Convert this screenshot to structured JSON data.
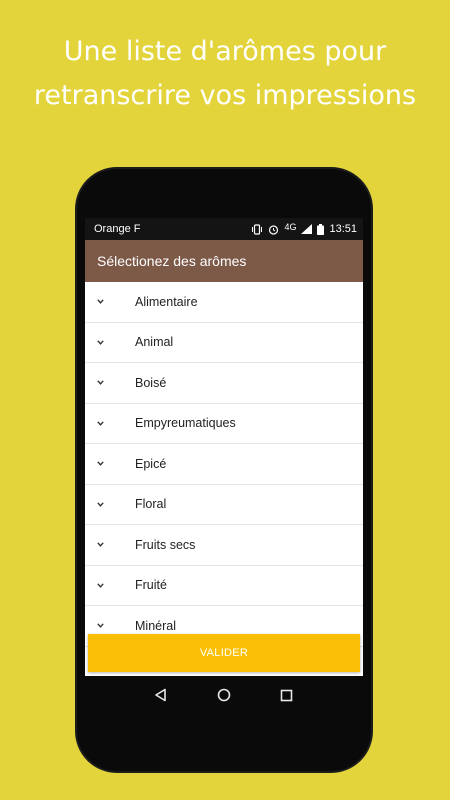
{
  "headline": {
    "line1": "Une liste d'arômes pour",
    "line2": "retranscrire vos impressions"
  },
  "statusbar": {
    "carrier": "Orange F",
    "network": "4G",
    "time": "13:51",
    "icons": [
      "vibrate-icon",
      "alarm-icon",
      "signal-icon",
      "battery-icon"
    ]
  },
  "appbar": {
    "title": "Sélectionez des arômes",
    "color": "#7d5948"
  },
  "list": {
    "items": [
      {
        "label": "Alimentaire"
      },
      {
        "label": "Animal"
      },
      {
        "label": "Boisé"
      },
      {
        "label": "Empyreumatiques"
      },
      {
        "label": "Epicé"
      },
      {
        "label": "Floral"
      },
      {
        "label": "Fruits secs"
      },
      {
        "label": "Fruité"
      },
      {
        "label": "Minéral"
      }
    ]
  },
  "button": {
    "label": "VALIDER",
    "color": "#fbc006"
  },
  "navbar": {
    "icons": [
      "back-icon",
      "home-icon",
      "recents-icon"
    ]
  },
  "colors": {
    "background": "#e3d43c"
  }
}
